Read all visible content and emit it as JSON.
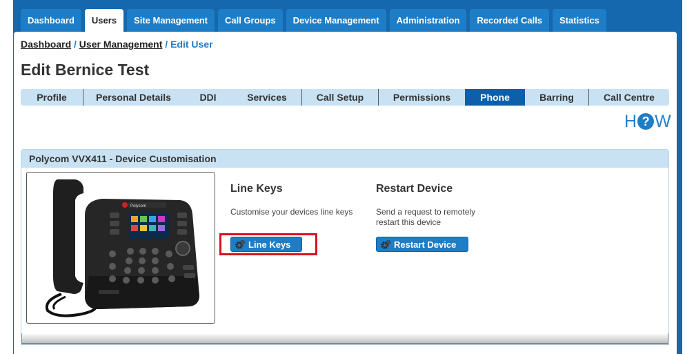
{
  "top_nav": {
    "tabs": [
      {
        "label": "Dashboard"
      },
      {
        "label": "Users",
        "active": true
      },
      {
        "label": "Site Management"
      },
      {
        "label": "Call Groups"
      },
      {
        "label": "Device Management"
      },
      {
        "label": "Administration"
      },
      {
        "label": "Recorded Calls"
      },
      {
        "label": "Statistics"
      }
    ]
  },
  "breadcrumb": {
    "items": [
      "Dashboard",
      "User Management"
    ],
    "separator": "/",
    "current": "Edit User"
  },
  "page_title": "Edit Bernice Test",
  "subtabs": [
    {
      "label": "Profile"
    },
    {
      "label": "Personal Details"
    },
    {
      "label": "DDI"
    },
    {
      "label": "Services"
    },
    {
      "label": "Call Setup"
    },
    {
      "label": "Permissions"
    },
    {
      "label": "Phone",
      "active": true
    },
    {
      "label": "Barring"
    },
    {
      "label": "Call Centre"
    }
  ],
  "how_logo": {
    "h": "H",
    "q": "?",
    "w": "W"
  },
  "panel": {
    "title": "Polycom VVX411 - Device Customisation",
    "phone_brand": "Polycom",
    "line_keys": {
      "title": "Line Keys",
      "description": "Customise your devices line keys",
      "button_label": "Line Keys"
    },
    "restart": {
      "title": "Restart Device",
      "description": "Send a request to remotely restart this device",
      "button_label": "Restart Device"
    }
  },
  "colors": {
    "brand_blue": "#1e7dc7",
    "active_tab": "#0e5ea8",
    "light_blue": "#c8e2f3",
    "highlight_red": "#d9101f"
  }
}
